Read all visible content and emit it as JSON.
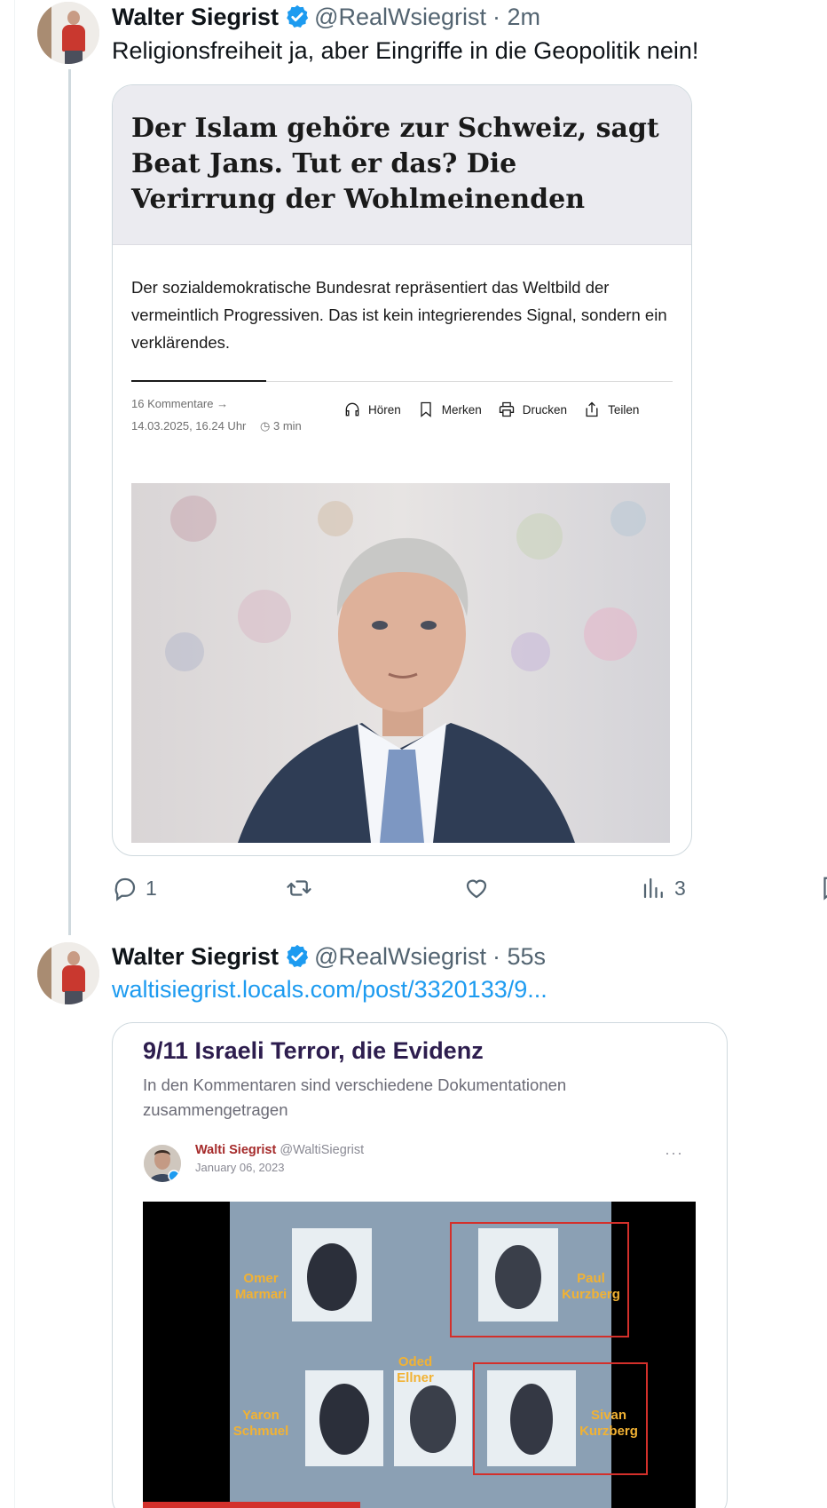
{
  "tweets": [
    {
      "name": "Walter Siegrist",
      "handle": "@RealWsiegrist",
      "time": "· 2m",
      "text": "Religionsfreiheit ja, aber Eingriffe in die Geopolitik nein!",
      "card": {
        "headline": "Der Islam gehöre zur Schweiz, sagt Beat Jans. Tut er das? Die Verirrung der Wohlmeinenden",
        "teaser": "Der sozialdemokratische Bundesrat repräsentiert das Weltbild der vermeintlich Progressiven. Das ist kein integrierendes Signal, sondern ein verklärendes.",
        "comments": "16 Kommentare →",
        "date": "14.03.2025, 16.24 Uhr",
        "read_time": "3 min",
        "actions": {
          "listen": "Hören",
          "save": "Merken",
          "print": "Drucken",
          "share": "Teilen"
        }
      },
      "stats": {
        "replies": "1",
        "reposts": "",
        "likes": "",
        "views": "3"
      }
    },
    {
      "name": "Walter Siegrist",
      "handle": "@RealWsiegrist",
      "time": "· 55s",
      "link": "waltisiegrist.locals.com/post/3320133/9...",
      "card": {
        "title": "9/11 Israeli Terror, die Evidenz",
        "subtitle": "In den Kommentaren sind verschiedene Dokumentationen zusammengetragen",
        "author_name": "Walti Siegrist",
        "author_handle": "@WaltiSiegrist",
        "date": "January 06, 2023",
        "more": "···",
        "video_labels": [
          "Omer Marmari",
          "Paul Kurzberg",
          "Oded Ellner",
          "Yaron Schmuel",
          "Sivan Kurzberg"
        ]
      }
    }
  ],
  "colors": {
    "accent": "#1d9bf0",
    "text": "#0f1419",
    "muted": "#536471",
    "card_border": "#cfd9de"
  }
}
